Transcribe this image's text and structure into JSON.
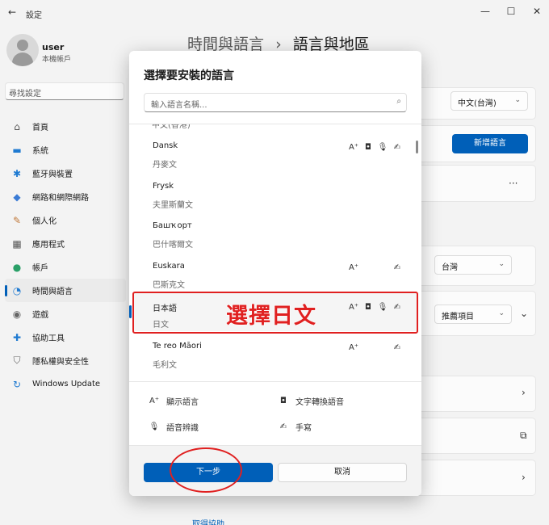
{
  "window": {
    "back_glyph": "←",
    "title": "設定",
    "minimize": "—",
    "maximize": "☐",
    "close": "✕"
  },
  "profile": {
    "name": "user",
    "type": "本機帳戶"
  },
  "sidebar": {
    "search_placeholder": "尋找設定",
    "items": [
      {
        "label": "首頁",
        "icon": "home-icon",
        "glyph": "⌂",
        "color": "#555555"
      },
      {
        "label": "系統",
        "icon": "monitor-icon",
        "glyph": "▬",
        "color": "#1f7ad1"
      },
      {
        "label": "藍牙與裝置",
        "icon": "bluetooth-icon",
        "glyph": "✱",
        "color": "#1f7ad1"
      },
      {
        "label": "網路和網際網路",
        "icon": "wifi-icon",
        "glyph": "◆",
        "color": "#3a7bd5"
      },
      {
        "label": "個人化",
        "icon": "brush-icon",
        "glyph": "✎",
        "color": "#c0783a"
      },
      {
        "label": "應用程式",
        "icon": "apps-icon",
        "glyph": "▦",
        "color": "#555555"
      },
      {
        "label": "帳戶",
        "icon": "person-icon",
        "glyph": "●",
        "color": "#2aa068"
      },
      {
        "label": "時間與語言",
        "icon": "clock-globe-icon",
        "glyph": "◔",
        "color": "#1f7ad1",
        "active": true
      },
      {
        "label": "遊戲",
        "icon": "gamepad-icon",
        "glyph": "◉",
        "color": "#666666"
      },
      {
        "label": "協助工具",
        "icon": "accessibility-icon",
        "glyph": "✚",
        "color": "#1f7ad1"
      },
      {
        "label": "隱私權與安全性",
        "icon": "shield-icon",
        "glyph": "⛉",
        "color": "#666666"
      },
      {
        "label": "Windows Update",
        "icon": "update-icon",
        "glyph": "↻",
        "color": "#1f7ad1"
      }
    ]
  },
  "header": {
    "crumb": "時間與語言",
    "separator": "›",
    "title": "語言與地區"
  },
  "background": {
    "display_language_value": "中文(台灣)",
    "add_language_label": "新增語言",
    "more_glyph": "···",
    "region_value": "台灣",
    "format_value": "推薦項目",
    "help_link": "取得協助"
  },
  "dialog": {
    "title": "選擇要安裝的語言",
    "search_placeholder": "輸入語言名稱...",
    "search_icon": "magnifier-icon",
    "partial_item": "中文(香港)",
    "languages": [
      {
        "name": "Dansk",
        "native": "丹麥文",
        "features": [
          "display",
          "tts",
          "speech",
          "handwriting"
        ]
      },
      {
        "name": "Frysk",
        "native": "夫里斯蘭文",
        "features": []
      },
      {
        "name": "Башҡорт",
        "native": "巴什喀爾文",
        "features": []
      },
      {
        "name": "Euskara",
        "native": "巴斯克文",
        "features": [
          "display",
          "handwriting"
        ]
      },
      {
        "name": "日本語",
        "native": "日文",
        "features": [
          "display",
          "tts",
          "speech",
          "handwriting"
        ],
        "selected": true
      },
      {
        "name": "Te reo Māori",
        "native": "毛利文",
        "features": [
          "display",
          "handwriting"
        ]
      }
    ],
    "feature_glyphs": {
      "display": "A⁺",
      "tts": "◘",
      "speech": "🎙",
      "handwriting": "✍"
    },
    "legend": {
      "display": "顯示語言",
      "tts": "文字轉換語音",
      "speech": "語音辨識",
      "handwriting": "手寫"
    },
    "next_label": "下一步",
    "cancel_label": "取消"
  },
  "annotations": {
    "select_japanese": "選擇日文",
    "accent_color": "#e02020"
  },
  "colors": {
    "accent": "#005fb8"
  }
}
